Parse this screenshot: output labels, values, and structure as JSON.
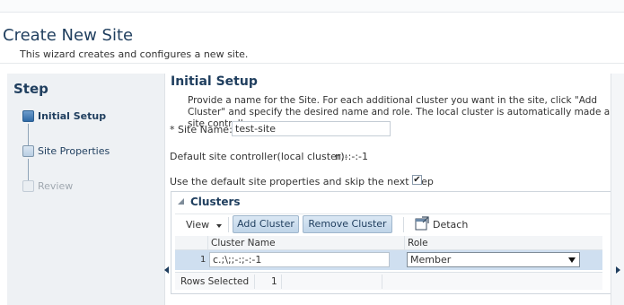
{
  "page": {
    "title": "Create New Site",
    "subtitle": "This wizard creates and configures a new site."
  },
  "train": {
    "title": "Step",
    "steps": [
      {
        "label": "Initial Setup",
        "state": "current"
      },
      {
        "label": "Site Properties",
        "state": "enabled"
      },
      {
        "label": "Review",
        "state": "disabled"
      }
    ]
  },
  "main": {
    "section_title": "Initial Setup",
    "instructions": "Provide a name for the Site. For each additional cluster you want in the site, click \"Add Cluster\" and specify the desired name and role. The local cluster is automatically made a site controller.",
    "site_name_label": "* Site Name:",
    "site_name_value": "test-site",
    "default_controller_label": "Default site controller(local cluster):",
    "default_controller_value": "n;-:-:-1",
    "skip_label": "Use the default site properties and skip the next step",
    "skip_checked": true,
    "skip_check_glyph": "✔"
  },
  "clusters": {
    "title": "Clusters",
    "toolbar": {
      "view_label": "View",
      "add_label": "Add Cluster",
      "remove_label": "Remove Cluster",
      "detach_label": "Detach"
    },
    "columns": [
      "Cluster Name",
      "Role"
    ],
    "rows": [
      {
        "num": "1",
        "name": "c.;\\;;-:;-:-1",
        "role": "Member"
      }
    ],
    "rows_selected_label": "Rows Selected",
    "rows_selected_value": "1"
  },
  "colors": {
    "title": "#1f3e5e",
    "button_bg": "#c9dbed",
    "selected_row": "#cfdff0"
  }
}
